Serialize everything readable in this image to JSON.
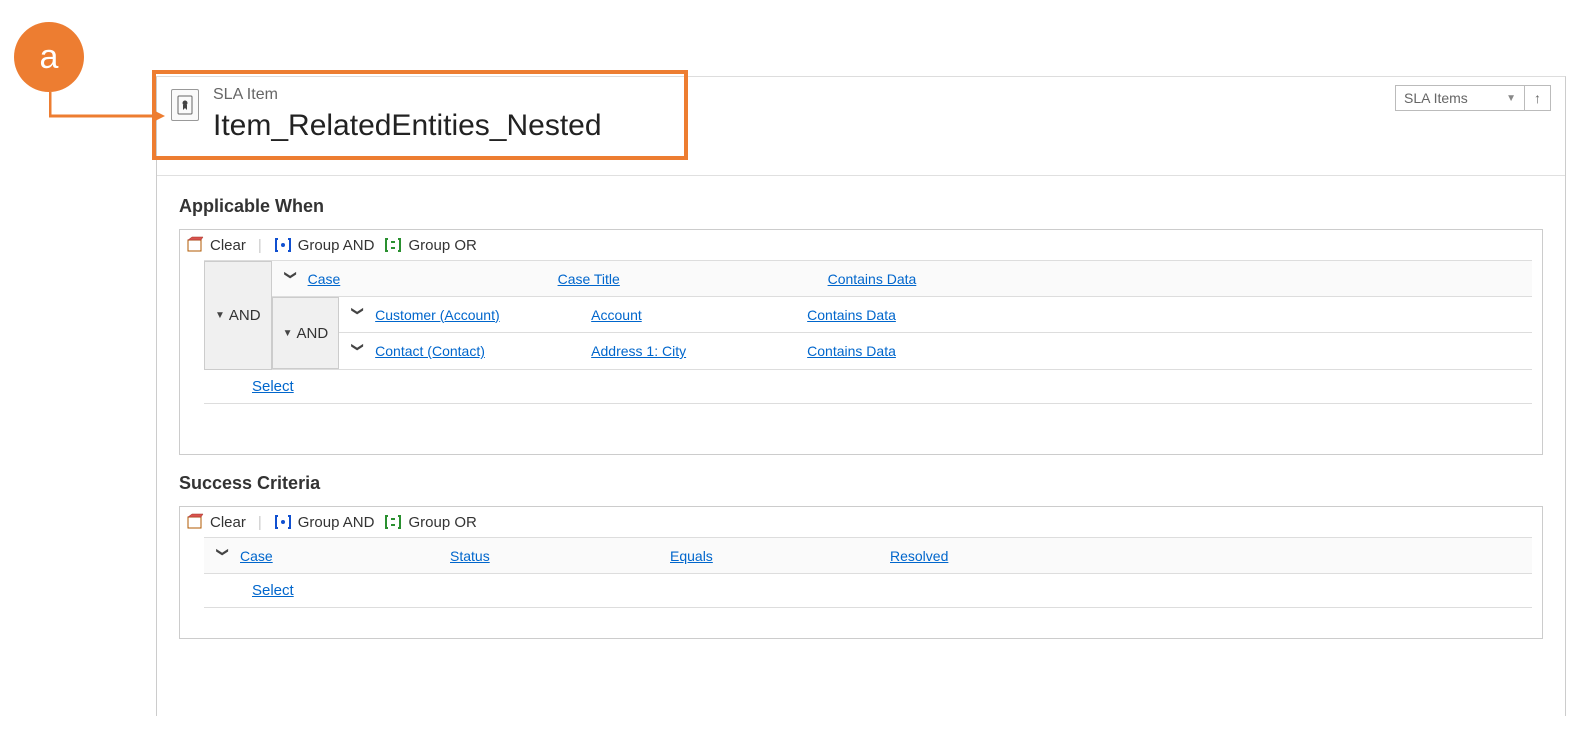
{
  "callout": {
    "label": "a"
  },
  "header": {
    "entity_type": "SLA Item",
    "title": "Item_RelatedEntities_Nested",
    "nav_select": "SLA Items"
  },
  "toolbar": {
    "clear": "Clear",
    "group_and": "Group AND",
    "group_or": "Group OR",
    "and_label": "AND",
    "select_label": "Select"
  },
  "applicable_when": {
    "title": "Applicable When",
    "row0": {
      "entity": "Case",
      "field": "Case Title",
      "op": "Contains Data"
    },
    "nested": {
      "row0": {
        "entity": "Customer (Account)",
        "field": "Account",
        "op": "Contains Data"
      },
      "row1": {
        "entity": "Contact (Contact)",
        "field": "Address 1: City",
        "op": "Contains Data"
      }
    }
  },
  "success_criteria": {
    "title": "Success Criteria",
    "row0": {
      "entity": "Case",
      "field": "Status",
      "op": "Equals",
      "value": "Resolved"
    }
  }
}
